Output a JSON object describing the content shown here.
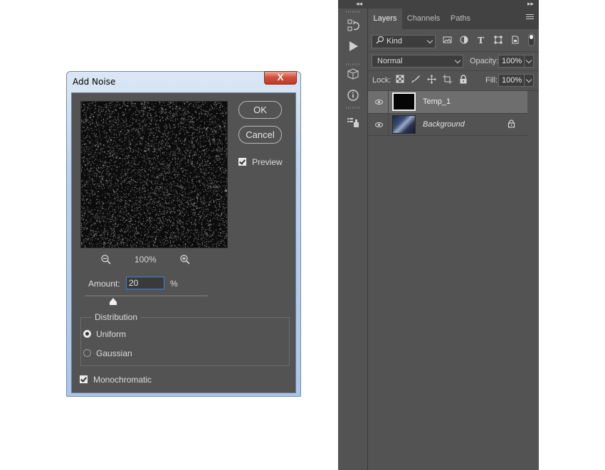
{
  "dialog": {
    "title": "Add Noise",
    "close_label": "X",
    "ok_label": "OK",
    "cancel_label": "Cancel",
    "preview_label": "Preview",
    "preview_checked": true,
    "zoom_level": "100%",
    "amount_label": "Amount:",
    "amount_value": "20",
    "amount_unit": "%",
    "amount_slider_fraction": 0.2,
    "distribution": {
      "title": "Distribution",
      "options": [
        "Uniform",
        "Gaussian"
      ],
      "selected": "Uniform"
    },
    "monochromatic_label": "Monochromatic",
    "monochromatic_checked": true
  },
  "layers_panel": {
    "tabs": [
      "Layers",
      "Channels",
      "Paths"
    ],
    "active_tab": "Layers",
    "filter_kind": "Kind",
    "blend_mode": "Normal",
    "opacity_label": "Opacity:",
    "opacity_value": "100%",
    "lock_label": "Lock:",
    "fill_label": "Fill:",
    "fill_value": "100%",
    "layers": [
      {
        "name": "Temp_1",
        "selected": true,
        "visible": true,
        "locked": false
      },
      {
        "name": "Background",
        "selected": false,
        "visible": true,
        "locked": true
      }
    ]
  },
  "colors": {
    "panel_bg": "#535353",
    "panel_dark": "#424242",
    "selected_layer": "#6e6e6e",
    "input_focus": "#4a7fd0",
    "close_button": "#c03a26"
  }
}
